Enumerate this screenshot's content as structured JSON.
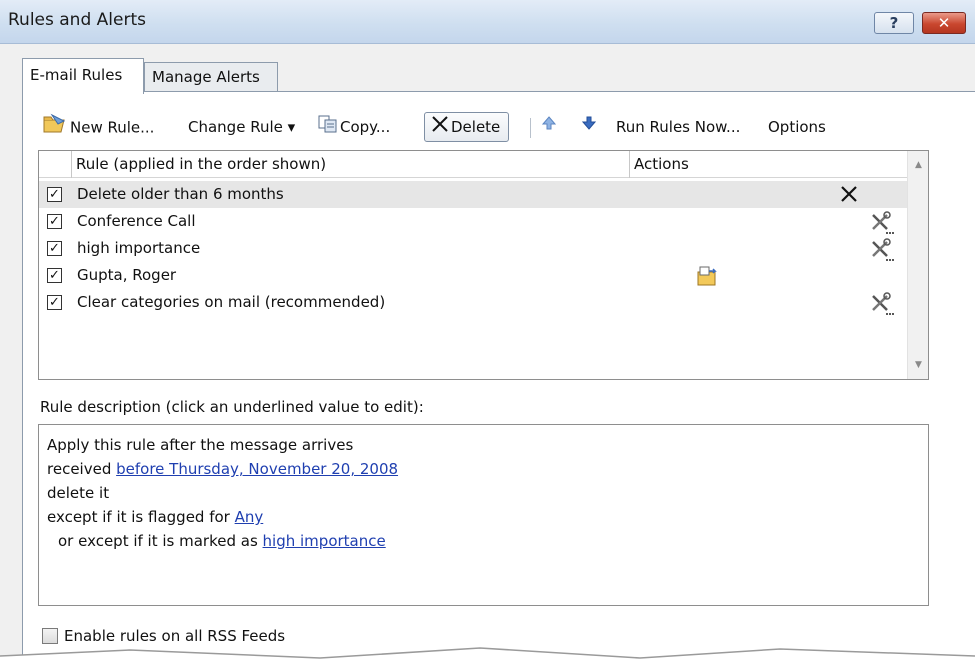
{
  "window": {
    "title": "Rules and Alerts",
    "help_label": "?",
    "close_label": "✕"
  },
  "tabs": [
    {
      "label": "E-mail Rules",
      "active": true
    },
    {
      "label": "Manage Alerts",
      "active": false
    }
  ],
  "toolbar": {
    "new_rule": "New Rule...",
    "change_rule": "Change Rule ▾",
    "copy": "Copy...",
    "delete": "Delete",
    "run_rules": "Run Rules Now...",
    "options": "Options"
  },
  "rules_list": {
    "header_rule": "Rule (applied in the order shown)",
    "header_actions": "Actions",
    "rows": [
      {
        "name": "Delete older than 6 months",
        "checked": true,
        "selected": true,
        "action_icon": "delete-x-icon"
      },
      {
        "name": "Conference Call",
        "checked": true,
        "selected": false,
        "action_icon": "tools-icon"
      },
      {
        "name": "high importance",
        "checked": true,
        "selected": false,
        "action_icon": "tools-icon"
      },
      {
        "name": "Gupta, Roger",
        "checked": true,
        "selected": false,
        "action_icon": "move-to-folder-icon"
      },
      {
        "name": "Clear categories on mail (recommended)",
        "checked": true,
        "selected": false,
        "action_icon": "tools-icon"
      }
    ]
  },
  "description": {
    "label": "Rule description (click an underlined value to edit):",
    "line1": "Apply this rule after the message arrives",
    "line2_prefix": "received ",
    "line2_link": "before Thursday, November 20, 2008",
    "line3": "delete it",
    "line4_prefix": "except if it is flagged for ",
    "line4_link": "Any",
    "line5_prefix": "or except if it is marked as ",
    "line5_link": "high importance"
  },
  "rss": {
    "label": "Enable rules on all RSS Feeds",
    "checked": false
  },
  "colors": {
    "link": "#1f3fb0",
    "selected_row": "#e6e6e6",
    "close_button": "#c9472f"
  }
}
